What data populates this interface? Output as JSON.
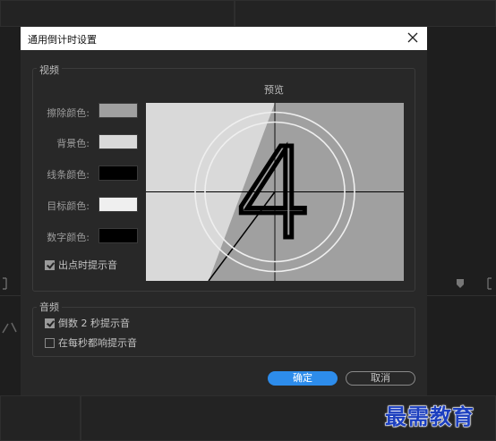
{
  "dialog": {
    "title": "通用倒计时设置",
    "video_group": "视频",
    "preview_label": "预览",
    "rows": [
      {
        "label": "擦除颜色:",
        "color": "#a0a0a0"
      },
      {
        "label": "背景色:",
        "color": "#d9d9d9"
      },
      {
        "label": "线条颜色:",
        "color": "#000000"
      },
      {
        "label": "目标颜色:",
        "color": "#efefef"
      },
      {
        "label": "数字颜色:",
        "color": "#000000"
      }
    ],
    "cue_at_out": {
      "label": "出点时提示音",
      "checked": true
    },
    "preview_digit": "4",
    "audio_group": "音频",
    "cue_countdown": {
      "label": "倒数 2 秒提示音",
      "checked": true
    },
    "cue_every_second": {
      "label": "在每秒都响提示音",
      "checked": false
    },
    "ok_label": "确定",
    "cancel_label": "取消"
  },
  "watermark": "最需教育"
}
